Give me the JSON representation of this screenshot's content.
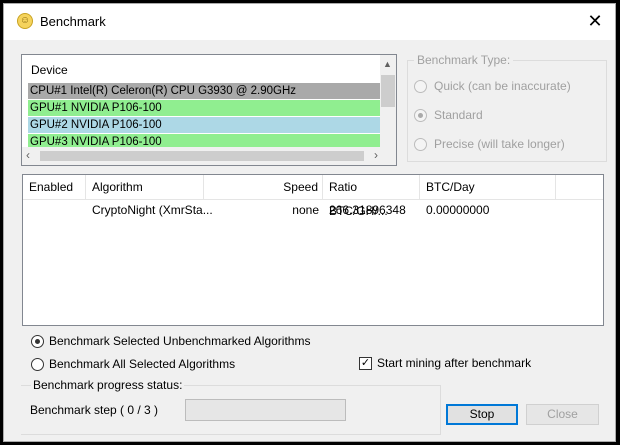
{
  "window": {
    "title": "Benchmark",
    "app_icon": "smiley-icon",
    "close_icon": "✕"
  },
  "device_list": {
    "header": "Device",
    "rows": [
      {
        "label": "CPU#1 Intel(R) Celeron(R) CPU G3930 @ 2.90GHz",
        "color": "#a9a9a9"
      },
      {
        "label": "GPU#1 NVIDIA P106-100",
        "color": "#90ee90"
      },
      {
        "label": "GPU#2 NVIDIA P106-100",
        "color": "#add8e6"
      },
      {
        "label": "GPU#3 NVIDIA P106-100",
        "color": "#90ee90"
      }
    ]
  },
  "benchmark_type": {
    "legend": "Benchmark Type:",
    "options": [
      {
        "label": "Quick (can be inaccurate)",
        "selected": false
      },
      {
        "label": "Standard",
        "selected": true
      },
      {
        "label": "Precise (will take longer)",
        "selected": false
      }
    ]
  },
  "algorithms": {
    "columns": [
      "Enabled",
      "Algorithm",
      "Speed",
      "Ratio BTC/GH/...",
      "BTC/Day"
    ],
    "rows": [
      {
        "enabled": "",
        "algorithm": "CryptoNight (XmrSta...",
        "speed": "none",
        "ratio": "266.31896348",
        "btc_day": "0.00000000"
      }
    ]
  },
  "mode": {
    "unbenchmarked": "Benchmark Selected Unbenchmarked Algorithms",
    "all_selected": "Benchmark All Selected Algorithms",
    "start_mining": "Start mining after benchmark",
    "start_mining_checked": true
  },
  "progress": {
    "legend": "Benchmark progress status:",
    "step": "Benchmark step ( 0 / 3 )",
    "value": 0
  },
  "buttons": {
    "stop": "Stop",
    "close": "Close"
  }
}
